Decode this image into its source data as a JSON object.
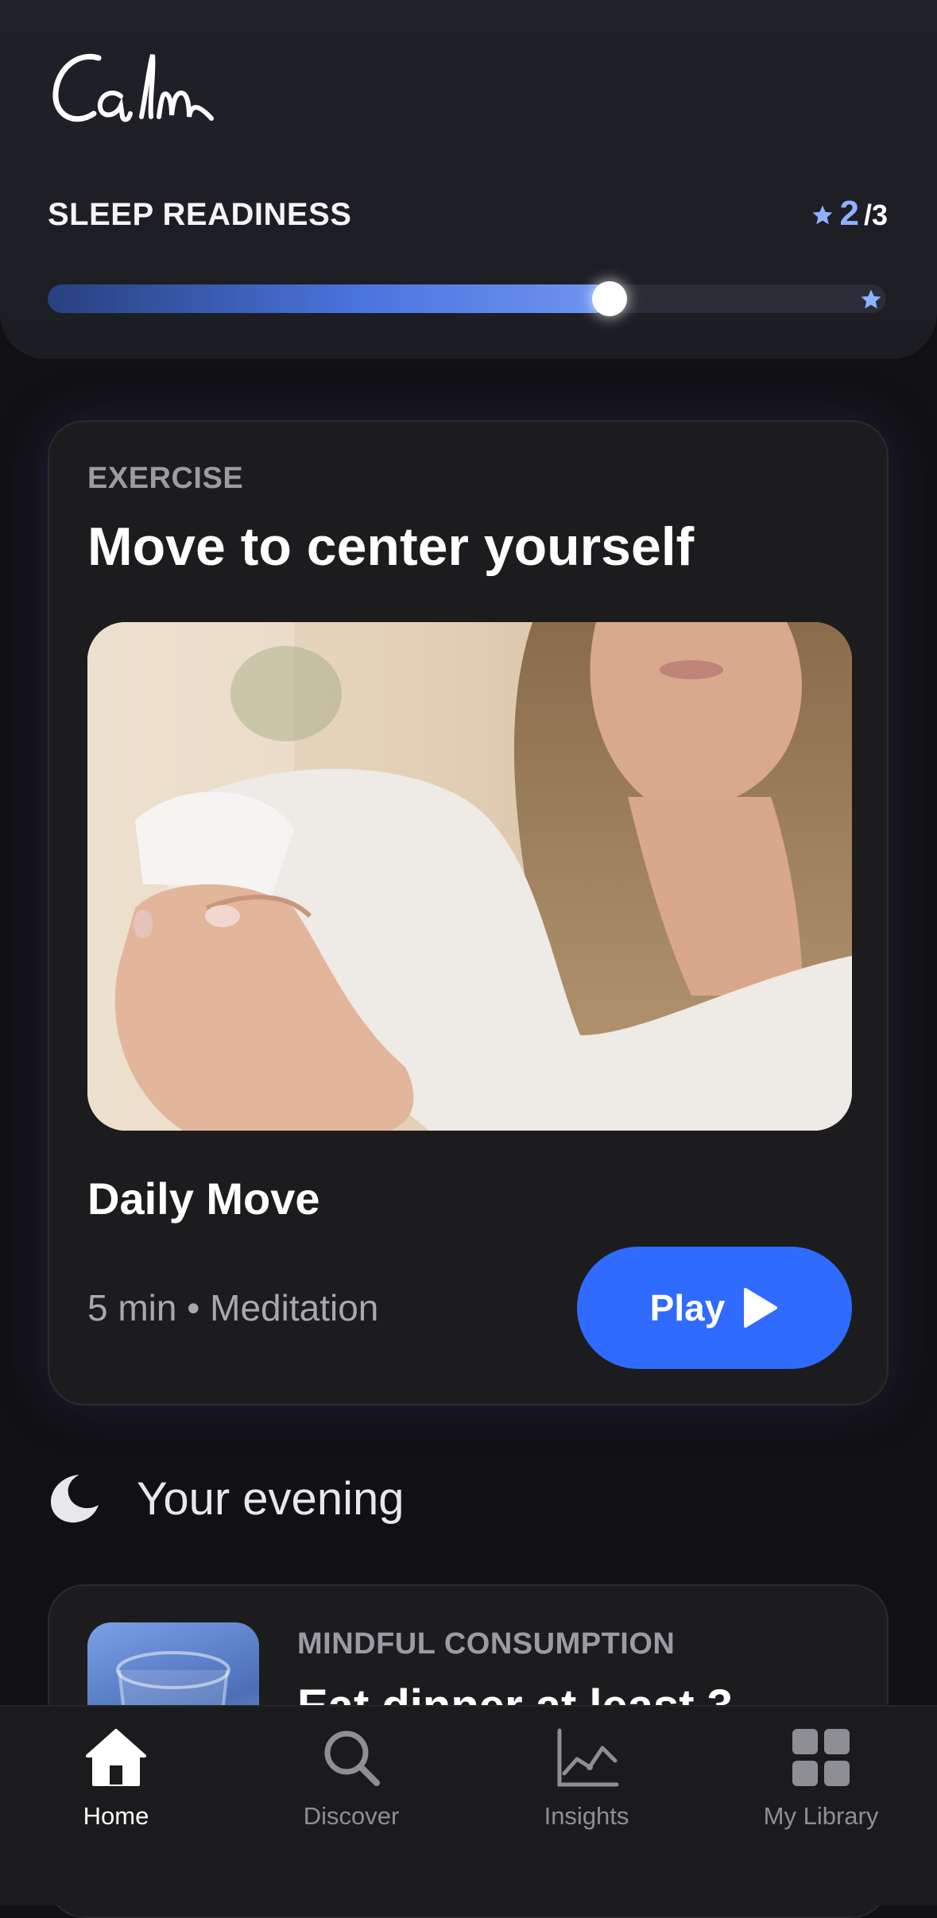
{
  "app": {
    "logo_text": "Calm"
  },
  "sleep_readiness": {
    "label": "SLEEP READINESS",
    "score": "2",
    "total": "/3",
    "progress": 0.67,
    "colors": {
      "score": "#8fb1ff",
      "fill_end": "#6f95f2"
    }
  },
  "exercise_card": {
    "eyebrow": "EXERCISE",
    "title": "Move to center yourself",
    "image_icon": "photo-woman-stretching",
    "session_title": "Daily Move",
    "meta": "5 min • Meditation",
    "play_label": "Play",
    "accent": "#2f6bff"
  },
  "evening": {
    "label": "Your evening",
    "icon": "moon-icon"
  },
  "second_card": {
    "eyebrow": "MINDFUL CONSUMPTION",
    "title": "Eat dinner at least 3"
  },
  "tabbar": {
    "items": [
      {
        "label": "Home",
        "icon": "home-icon",
        "active": true
      },
      {
        "label": "Discover",
        "icon": "search-icon",
        "active": false
      },
      {
        "label": "Insights",
        "icon": "chart-icon",
        "active": false
      },
      {
        "label": "My Library",
        "icon": "grid-icon",
        "active": false
      }
    ]
  }
}
